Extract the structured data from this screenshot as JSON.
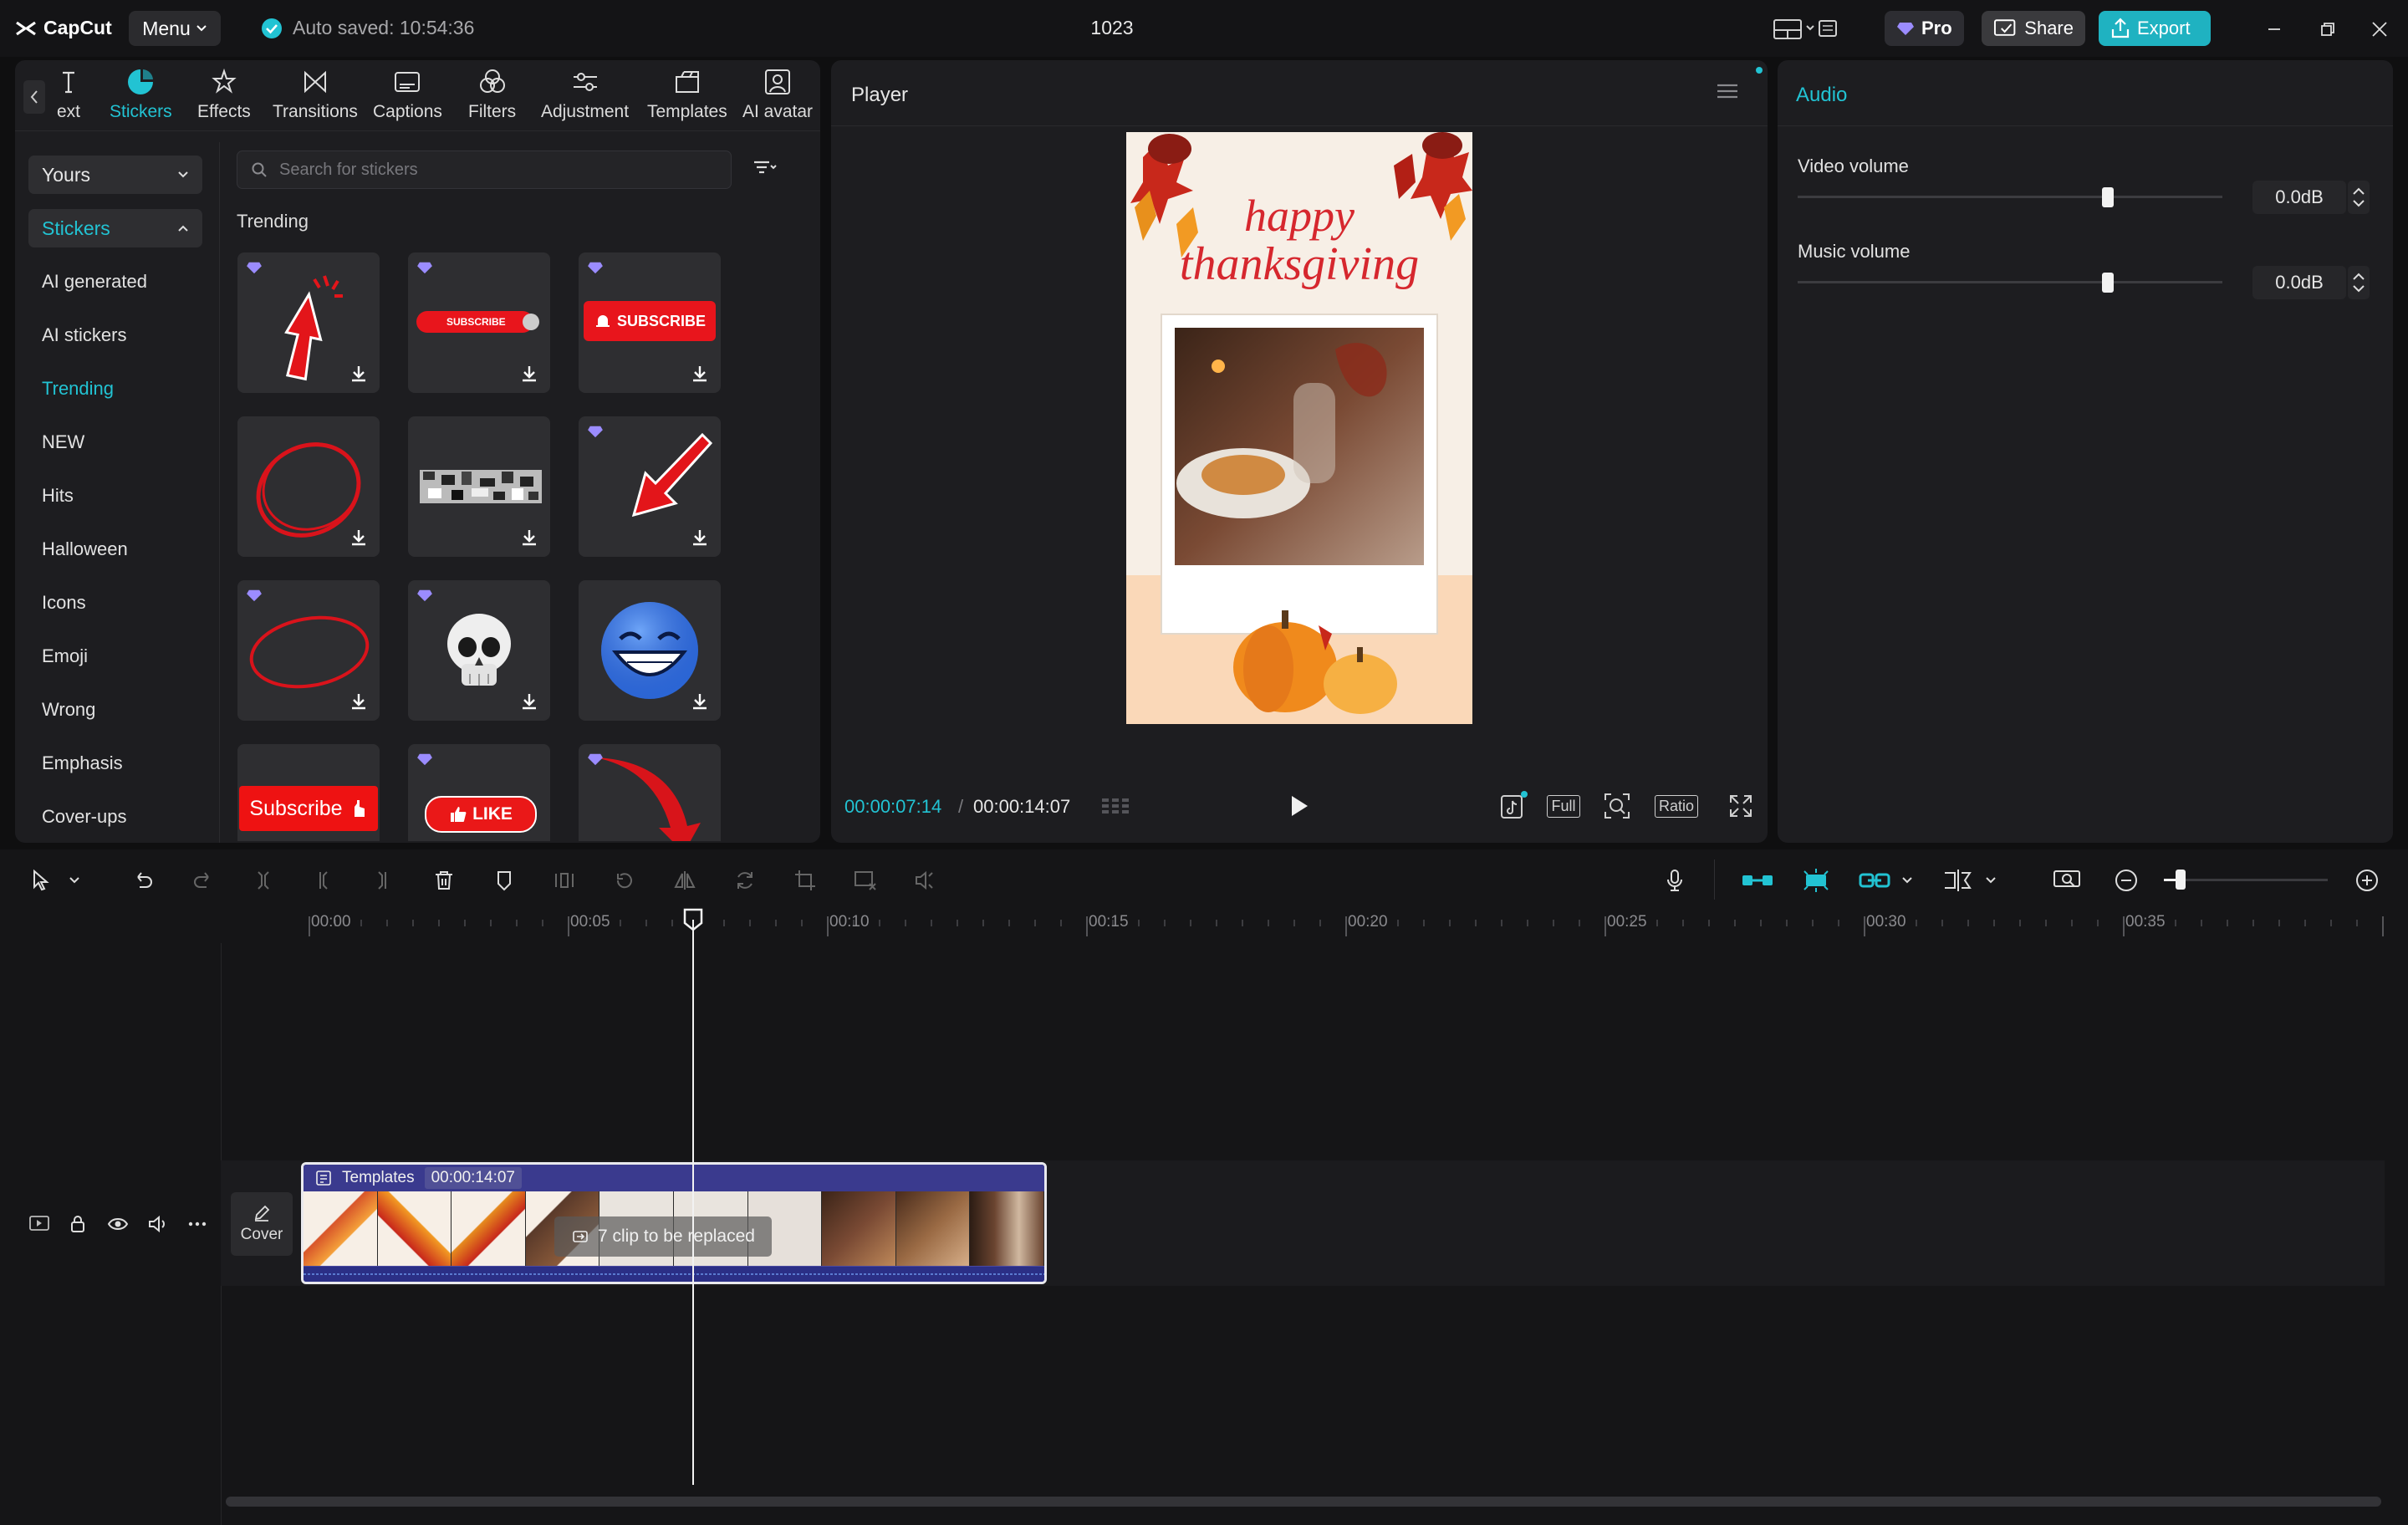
{
  "titlebar": {
    "app_name": "CapCut",
    "menu_label": "Menu",
    "autosave_text": "Auto saved: 10:54:36",
    "project_title": "1023",
    "pro_label": "Pro",
    "share_label": "Share",
    "export_label": "Export"
  },
  "tooltabs": [
    {
      "label": "ext",
      "icon": "text-icon"
    },
    {
      "label": "Stickers",
      "icon": "stickers-icon",
      "active": true
    },
    {
      "label": "Effects",
      "icon": "effects-icon"
    },
    {
      "label": "Transitions",
      "icon": "transitions-icon"
    },
    {
      "label": "Captions",
      "icon": "captions-icon"
    },
    {
      "label": "Filters",
      "icon": "filters-icon"
    },
    {
      "label": "Adjustment",
      "icon": "adjustment-icon"
    },
    {
      "label": "Templates",
      "icon": "templates-icon"
    },
    {
      "label": "AI avatar",
      "icon": "ai-avatar-icon"
    }
  ],
  "categories": {
    "dropdown_label": "Yours",
    "group_label": "Stickers",
    "items": [
      "AI generated",
      "AI stickers",
      "Trending",
      "NEW",
      "Hits",
      "Halloween",
      "Icons",
      "Emoji",
      "Wrong",
      "Emphasis",
      "Cover-ups"
    ],
    "active_item": "Trending"
  },
  "stickers_panel": {
    "search_placeholder": "Search for stickers",
    "section_title": "Trending",
    "tile_text": {
      "subscribe_small": "SUBSCRIBE",
      "subscribe_bell": "SUBSCRIBE",
      "subscribe_btn": "Subscribe",
      "like_btn": "LIKE"
    }
  },
  "player": {
    "title": "Player",
    "preview_text_1": "happy",
    "preview_text_2": "thanksgiving",
    "current_time": "00:00:07:14",
    "total_time": "00:00:14:07",
    "full_label": "Full",
    "ratio_label": "Ratio"
  },
  "audio": {
    "title": "Audio",
    "video_volume_label": "Video volume",
    "video_volume_value": "0.0dB",
    "video_volume_level": 0.73,
    "music_volume_label": "Music volume",
    "music_volume_value": "0.0dB",
    "music_volume_level": 0.73
  },
  "timeline": {
    "ruler_labels": [
      "00:00",
      "00:05",
      "00:10",
      "00:15",
      "00:20",
      "00:25",
      "00:30",
      "00:35"
    ],
    "cover_label": "Cover",
    "clip_title": "Templates",
    "clip_duration": "00:00:14:07",
    "clip_replace_text": "7 clip to be replaced",
    "zoom_level": 0.1
  },
  "colors": {
    "accent": "#22c3d3",
    "export": "#1fb2c1",
    "panel": "#1d1d20",
    "clip": "#3a3a8e"
  }
}
